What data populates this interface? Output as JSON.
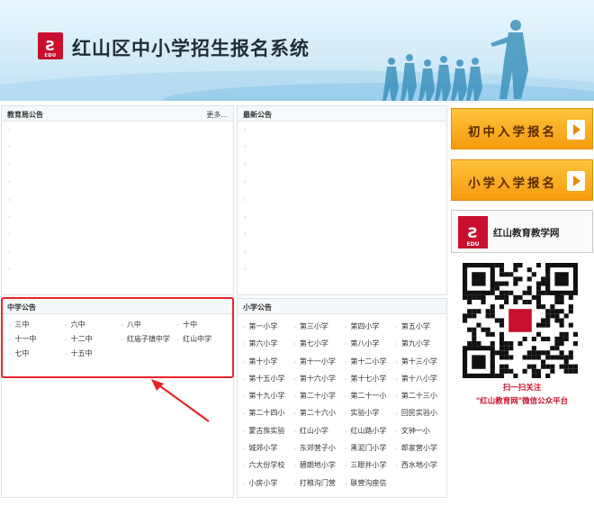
{
  "header": {
    "title": "红山区中小学招生报名系统",
    "logo_text": "EDU"
  },
  "education_panel": {
    "title": "教育局公告",
    "more_label": "更多..."
  },
  "latest_panel": {
    "title": "最新公告"
  },
  "middle_panel": {
    "title": "中学公告",
    "links": [
      "三中",
      "六中",
      "八中",
      "十中",
      "十一中",
      "十二中",
      "红庙子镇中学",
      "红山中学",
      "七中",
      "十五中"
    ]
  },
  "primary_panel": {
    "title": "小学公告",
    "links": [
      "第一小学",
      "第三小学",
      "第四小学",
      "第五小学",
      "第六小学",
      "第七小学",
      "第八小学",
      "第九小学",
      "第十小学",
      "第十一小学",
      "第十二小学",
      "第十三小学",
      "第十五小学",
      "第十六小学",
      "第十七小学",
      "第十八小学",
      "第十九小学",
      "第二十小学",
      "第二十一小",
      "第二十三小",
      "第二十四小",
      "第二十六小",
      "实验小学",
      "回民实验小",
      "蒙古族实验",
      "红山小学",
      "红山路小学",
      "文钟一小",
      "城郊小学",
      "东郊营子小",
      "黑泥门小学",
      "郎家营小学",
      "六大份学校",
      "碧朗地小学",
      "三眼井小学",
      "西水地小学",
      "小房小学",
      "打粮沟门营",
      "联营沟座信"
    ]
  },
  "sidebar": {
    "junior_button": "初中入学报名",
    "primary_button": "小学入学报名",
    "edu_site": "红山教育教学网",
    "edu_logo": "EDU",
    "qr_line1": "扫一扫关注",
    "qr_line2": "\"红山教育网\"微信公众平台"
  },
  "colors": {
    "accent_red": "#e8242b",
    "orange": "#f59b0f",
    "banner_blue": "#bfe1f3"
  }
}
